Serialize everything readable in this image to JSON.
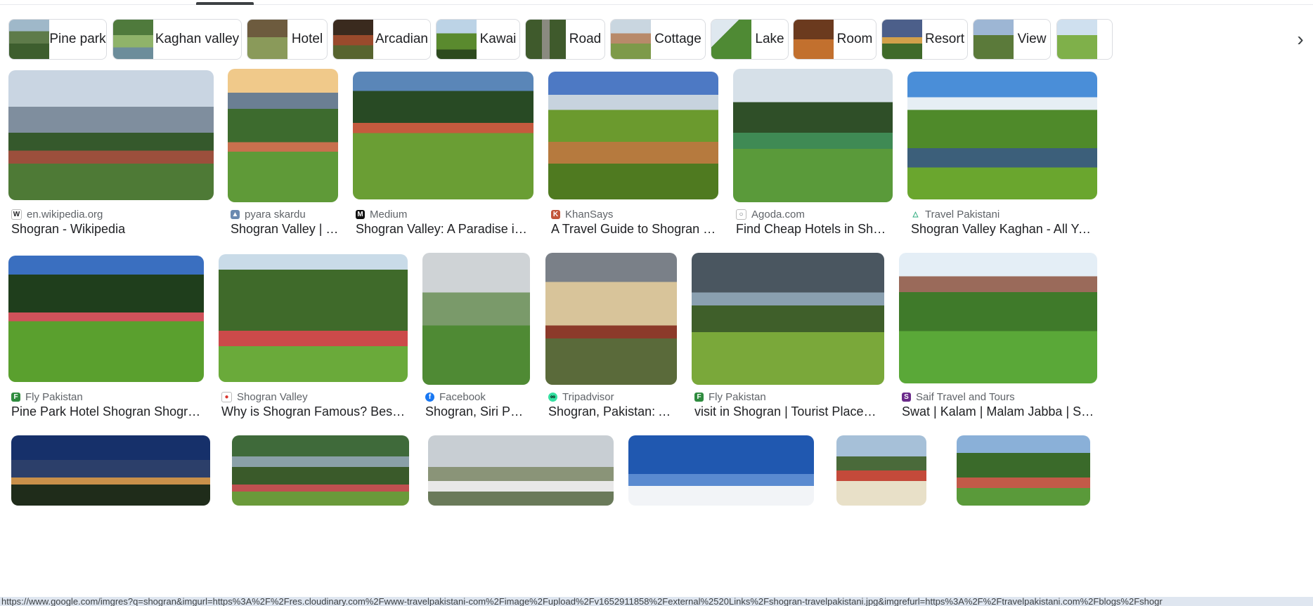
{
  "chips": [
    {
      "label": "Pine park"
    },
    {
      "label": "Kaghan valley"
    },
    {
      "label": "Hotel"
    },
    {
      "label": "Arcadian"
    },
    {
      "label": "Kawai"
    },
    {
      "label": "Road"
    },
    {
      "label": "Cottage"
    },
    {
      "label": "Lake"
    },
    {
      "label": "Room"
    },
    {
      "label": "Resort"
    },
    {
      "label": "View"
    }
  ],
  "chips_next_icon": "chevron-right-icon",
  "results_row1": [
    {
      "source": "en.wikipedia.org",
      "title": "Shogran - Wikipedia"
    },
    {
      "source": "pyara skardu",
      "title": "Shogran Valley | Na..."
    },
    {
      "source": "Medium",
      "title": "Shogran Valley: A Paradise in Paki..."
    },
    {
      "source": "KhanSays",
      "title": "A Travel Guide to Shogran | Kha..."
    },
    {
      "source": "Agoda.com",
      "title": "Find Cheap Hotels in Shogran..."
    },
    {
      "source": "Travel Pakistani",
      "title": "Shogran Valley Kaghan - All You Ne..."
    }
  ],
  "results_row2": [
    {
      "source": "Fly Pakistan",
      "title": "Pine Park Hotel Shogran Shogran Ho..."
    },
    {
      "source": "Shogran Valley",
      "title": "Why is Shogran Famous? Best Time..."
    },
    {
      "source": "Facebook",
      "title": "Shogran, Siri Paye..."
    },
    {
      "source": "Tripadvisor",
      "title": "Shogran, Pakistan: All Y..."
    },
    {
      "source": "Fly Pakistan",
      "title": "visit in Shogran | Tourist Places ..."
    },
    {
      "source": "Saif Travel and Tours",
      "title": "Swat | Kalam | Malam Jabba | Shogra..."
    }
  ],
  "status_url": "https://www.google.com/imgres?q=shogran&imgurl=https%3A%2F%2Fres.cloudinary.com%2Fwww-travelpakistani-com%2Fimage%2Fupload%2Fv1652911858%2Fexternal%2520Links%2Fshogran-travelpakistani.jpg&imgrefurl=https%3A%2F%2Ftravelpakistani.com%2Fblogs%2Fshogr"
}
